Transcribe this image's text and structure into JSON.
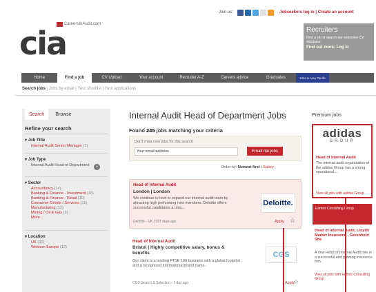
{
  "header": {
    "join_us": "Join us:",
    "links": "Jobseekers log in | Create an account",
    "site_name": "CareersInAudit.com",
    "logo_text": "cia"
  },
  "recruiters": {
    "title": "Recruiters",
    "desc": "Find a job or search our extensive CV database",
    "link": "Find out more: Log in"
  },
  "nav": {
    "items": [
      "Home",
      "Find a job",
      "CV Upload",
      "Your account",
      "Recruiter A-Z",
      "Careers advice",
      "Graduates",
      "Jobs in Asia Pacific"
    ]
  },
  "subnav": {
    "items": [
      "Search jobs",
      "Jobs by email",
      "Your shortlist",
      "Your applications"
    ]
  },
  "sidebar": {
    "tabs": [
      "Search",
      "Browse"
    ],
    "refine": "Refine your search",
    "job_title_heading": "Job Title",
    "job_title_item": "Internal Audit Senior Manager",
    "job_title_count": "(2)",
    "job_type_heading": "Job Type",
    "job_type_item": "Internal Audit Head of Department",
    "sector_heading": "Sector",
    "sectors": [
      {
        "name": "Accountancy",
        "count": "(14)"
      },
      {
        "name": "Banking & Finance - Investment",
        "count": "(16)"
      },
      {
        "name": "Banking & Finance - Retail",
        "count": "(10)"
      },
      {
        "name": "Consumer Goods / Services",
        "count": "(15)"
      },
      {
        "name": "Manufacturing",
        "count": "(12)"
      },
      {
        "name": "Mining / Oil & Gas",
        "count": "(9)"
      }
    ],
    "more": "More...",
    "location_heading": "Location",
    "locations": [
      {
        "name": "UK",
        "count": "(30)"
      },
      {
        "name": "Western Europe",
        "count": "(12)"
      }
    ]
  },
  "main": {
    "title": "Internal Audit Head of Department Jobs",
    "found_prefix": "Found",
    "found_count": "245",
    "found_suffix": "jobs matching your criteria",
    "alert_text": "Don't miss new jobs for this search",
    "email_placeholder": "Your email address",
    "email_button": "Email me jobs",
    "order_label": "Order by:",
    "order_newest": "Newest first",
    "order_salary": "Salary"
  },
  "jobs": [
    {
      "title": "Head of Internal Audit",
      "location": "London | London",
      "desc": "We continue to look to expand our internal audit team by attracting high performing new members. Deloitte offers successful candidates a uniq...",
      "meta": "Deloitte - UK | 597 days ago",
      "apply": "Apply",
      "logo": "Deloitte."
    },
    {
      "title": "Head of Internal Audit",
      "location": "Bristol | Highly competitive salary, bonus & benefits",
      "desc": "Our client is a leading FTSE 100 business with a global footprint and a recognised international brand name.",
      "meta": "CGS Search & Selection - 1 day ago",
      "apply": "Apply",
      "logo": "CGS"
    }
  ],
  "premium": {
    "heading": "Premium jobs",
    "adidas_logo": "adidas",
    "adidas_group": "GROUP",
    "job1_title": "Head of Internal Audit",
    "job1_desc": "The internal audit organization of the adidas Group has a strong operational ...",
    "job1_link": "View all jobs with adidas Group",
    "eames_text": "Eames Consulting Group",
    "job2_title": "Head of Internal Audit, Lloyds Market Insurance - Greenfield Site",
    "job2_desc": "A new Head of Internal Audit role in a successful and growing insurance firm.",
    "job2_link": "View all jobs with Eames Consulting Group"
  },
  "colors": {
    "accent": "#c4262e",
    "nav": "#5d5d5d"
  }
}
